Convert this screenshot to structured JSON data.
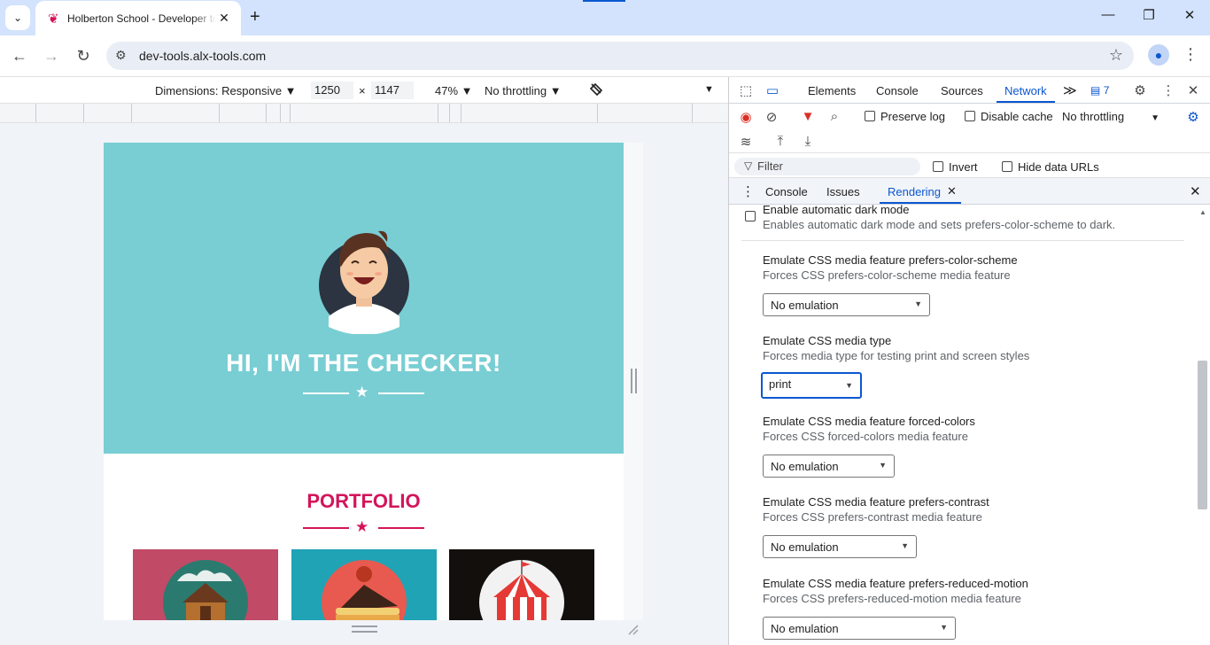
{
  "browser": {
    "tab_title": "Holberton School - Developer tools",
    "tab_close": "✕",
    "new_tab": "+",
    "url": "dev-tools.alx-tools.com",
    "window_minimize": "—",
    "window_restore": "❐",
    "window_close": "✕"
  },
  "device_toolbar": {
    "dimensions_label": "Dimensions: Responsive ▼",
    "width": "1250",
    "times": "×",
    "height": "1147",
    "zoom": "47% ▼",
    "throttling": "No throttling ▼",
    "more": "▼"
  },
  "page": {
    "hero_title": "HI, I'M THE CHECKER!",
    "portfolio_title": "PORTFOLIO",
    "colors": {
      "hero": "#79ced4",
      "accent": "#d4145a",
      "card1": "#c14a67",
      "card2": "#1fa3b5",
      "card3": "#130f0d"
    }
  },
  "devtools": {
    "tabs": [
      "Elements",
      "Console",
      "Sources",
      "Network"
    ],
    "more_tabs": "≫",
    "issues_count": "7",
    "network": {
      "preserve_log": "Preserve log",
      "disable_cache": "Disable cache",
      "throttling": "No throttling",
      "filter_placeholder": "Filter",
      "invert": "Invert",
      "hide_data_urls": "Hide data URLs"
    },
    "drawer_tabs": [
      "Console",
      "Issues",
      "Rendering"
    ],
    "rendering": {
      "dark_mode_title": "Enable automatic dark mode",
      "dark_mode_desc": "Enables automatic dark mode and sets prefers-color-scheme to dark.",
      "items": [
        {
          "title": "Emulate CSS media feature prefers-color-scheme",
          "desc": "Forces CSS prefers-color-scheme media feature",
          "value": "No emulation"
        },
        {
          "title": "Emulate CSS media type",
          "desc": "Forces media type for testing print and screen styles",
          "value": "print"
        },
        {
          "title": "Emulate CSS media feature forced-colors",
          "desc": "Forces CSS forced-colors media feature",
          "value": "No emulation"
        },
        {
          "title": "Emulate CSS media feature prefers-contrast",
          "desc": "Forces CSS prefers-contrast media feature",
          "value": "No emulation"
        },
        {
          "title": "Emulate CSS media feature prefers-reduced-motion",
          "desc": "Forces CSS prefers-reduced-motion media feature",
          "value": "No emulation"
        }
      ]
    }
  }
}
